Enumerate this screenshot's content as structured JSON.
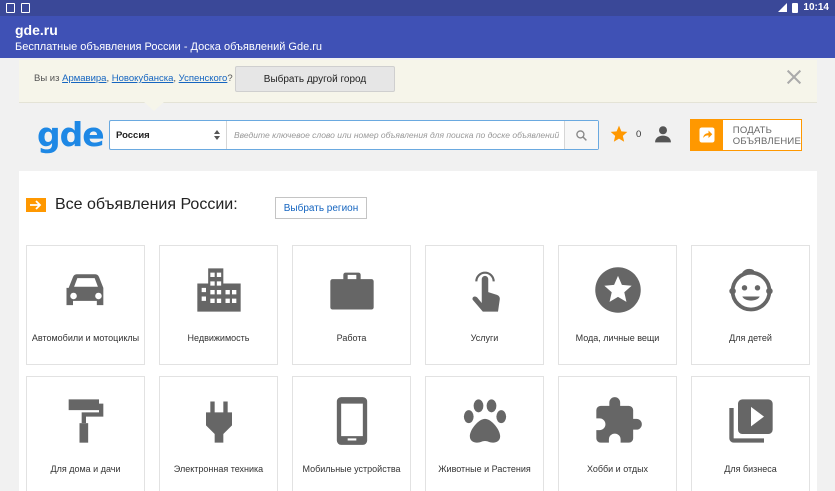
{
  "status_bar": {
    "time": "10:14"
  },
  "app_bar": {
    "title": "gde.ru",
    "subtitle": "Бесплатные объявления России - Доска объявлений Gde.ru"
  },
  "city_prompt": {
    "prefix": "Вы из ",
    "cities": [
      "Армавира",
      "Новокубанска",
      "Успенского"
    ],
    "sep1": ", ",
    "sep2": ", ",
    "suffix": "?",
    "choose_button": "Выбрать другой город"
  },
  "header": {
    "logo": "gde",
    "region_select": "Россия",
    "search_placeholder": "Введите ключевое слово или номер объявления для поиска по доске объявлений",
    "favorites_count": "0",
    "post_button": {
      "line1": "ПОДАТЬ",
      "line2": "ОБЪЯВЛЕНИЕ"
    }
  },
  "main": {
    "heading": "Все объявления России:",
    "region_button": "Выбрать регион",
    "categories": [
      {
        "label": "Автомобили и мотоциклы",
        "icon": "car-icon"
      },
      {
        "label": "Недвижимость",
        "icon": "building-icon"
      },
      {
        "label": "Работа",
        "icon": "briefcase-icon"
      },
      {
        "label": "Услуги",
        "icon": "hand-pointer-icon"
      },
      {
        "label": "Мода, личные вещи",
        "icon": "star-circle-icon"
      },
      {
        "label": "Для детей",
        "icon": "child-face-icon"
      },
      {
        "label": "Для дома и дачи",
        "icon": "paint-roller-icon"
      },
      {
        "label": "Электронная техника",
        "icon": "power-plug-icon"
      },
      {
        "label": "Мобильные устройства",
        "icon": "smartphone-icon"
      },
      {
        "label": "Животные и Растения",
        "icon": "paw-icon"
      },
      {
        "label": "Хобби и отдых",
        "icon": "puzzle-icon"
      },
      {
        "label": "Для бизнеса",
        "icon": "video-library-icon"
      }
    ]
  },
  "colors": {
    "status_bar": "#3a4898",
    "app_bar": "#3f51b5",
    "logo": "#1e88e5",
    "accent": "#ff9800",
    "icon": "#666666",
    "link": "#1565c0"
  }
}
